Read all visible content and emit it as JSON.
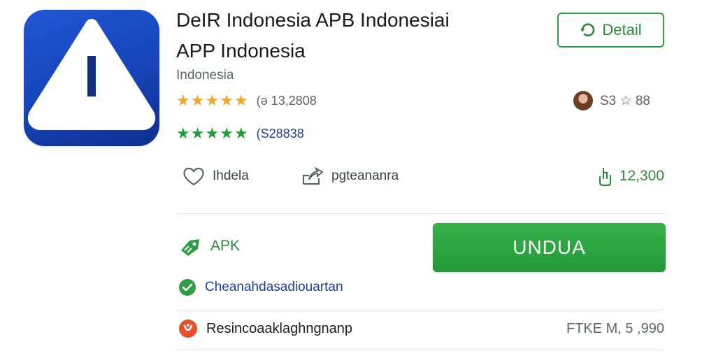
{
  "app": {
    "title_line1": "DeIR Indonesia APB Indonesiai",
    "title_line2": "APP Indonesia",
    "developer": "Indonesia"
  },
  "ratings": {
    "primary_count": "(ə 13,2808",
    "secondary_count": "(S28838"
  },
  "detail_button": {
    "label": "Detail"
  },
  "reviewer": {
    "text": "S3 ☆ 88"
  },
  "meta": {
    "left_label": "Ihdela",
    "middle_label": "pgteananra",
    "right_value": "12,300"
  },
  "apk": {
    "label": "APK"
  },
  "download_button": {
    "label": "UNDUA"
  },
  "verified": {
    "text": "Cheanahdasadiouartan"
  },
  "bottom": {
    "left_text": "Resincoaaklaghngnanp",
    "right_text": "FTKE M, 5 ,990"
  },
  "colors": {
    "brand_blue": "#1b4fcf",
    "accent_green": "#2e9e46",
    "star_gold": "#f5a623",
    "alert_orange": "#e8502a"
  },
  "icons": {
    "app_icon": "warning-triangle-icon",
    "detail": "refresh-arrow-icon",
    "heart": "heart-icon",
    "share": "share-icon",
    "download_count": "hand-icon",
    "apk": "android-tag-icon",
    "verified": "shield-check-icon",
    "bottom": "alert-badge-icon"
  }
}
